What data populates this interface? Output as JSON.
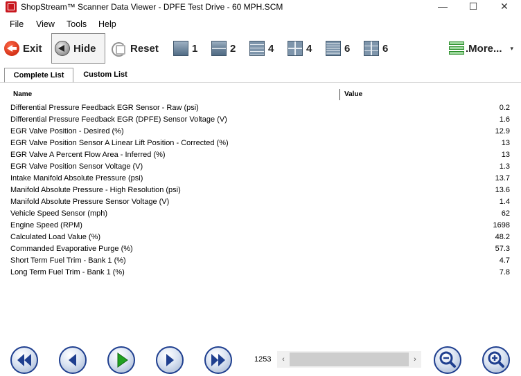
{
  "window": {
    "title": "ShopStream™ Scanner Data Viewer - DPFE Test Drive - 60 MPH.SCM",
    "controls": {
      "minimize": "—",
      "maximize": "☐",
      "close": "✕"
    }
  },
  "menu": [
    "File",
    "View",
    "Tools",
    "Help"
  ],
  "toolbar": {
    "exit": "Exit",
    "hide": "Hide",
    "reset": "Reset",
    "layouts": [
      "1",
      "2",
      "4",
      "4",
      "6",
      "6"
    ],
    "more": ".More...",
    "more_caret": "▾"
  },
  "tabs": [
    {
      "label": "Complete List",
      "active": true
    },
    {
      "label": "Custom List",
      "active": false
    }
  ],
  "grid": {
    "columns": {
      "name": "Name",
      "value": "Value"
    },
    "rows": [
      {
        "name": "Differential Pressure Feedback EGR Sensor - Raw (psi)",
        "value": "0.2"
      },
      {
        "name": "Differential Pressure Feedback EGR (DPFE) Sensor Voltage (V)",
        "value": "1.6"
      },
      {
        "name": "EGR Valve Position - Desired (%)",
        "value": "12.9"
      },
      {
        "name": "EGR Valve Position Sensor A Linear Lift Position - Corrected (%)",
        "value": "13"
      },
      {
        "name": "EGR Valve A Percent Flow Area - Inferred (%)",
        "value": "13"
      },
      {
        "name": "EGR Valve Position Sensor Voltage (V)",
        "value": "1.3"
      },
      {
        "name": "Intake Manifold Absolute Pressure (psi)",
        "value": "13.7"
      },
      {
        "name": "Manifold Absolute Pressure - High Resolution (psi)",
        "value": "13.6"
      },
      {
        "name": "Manifold Absolute Pressure Sensor Voltage (V)",
        "value": "1.4"
      },
      {
        "name": "Vehicle Speed Sensor (mph)",
        "value": "62"
      },
      {
        "name": "Engine Speed (RPM)",
        "value": "1698"
      },
      {
        "name": "Calculated Load Value (%)",
        "value": "48.2"
      },
      {
        "name": "Commanded Evaporative Purge (%)",
        "value": "57.3"
      },
      {
        "name": "Short Term Fuel Trim - Bank 1 (%)",
        "value": "4.7"
      },
      {
        "name": "Long Term Fuel Trim - Bank 1 (%)",
        "value": "7.8"
      }
    ]
  },
  "playback": {
    "frame": "1253",
    "scroll_left": "‹",
    "scroll_right": "›"
  },
  "colors": {
    "exit_accent": "#d21e00",
    "nav_ring": "#1f3f8f",
    "play_green": "#21a121"
  }
}
